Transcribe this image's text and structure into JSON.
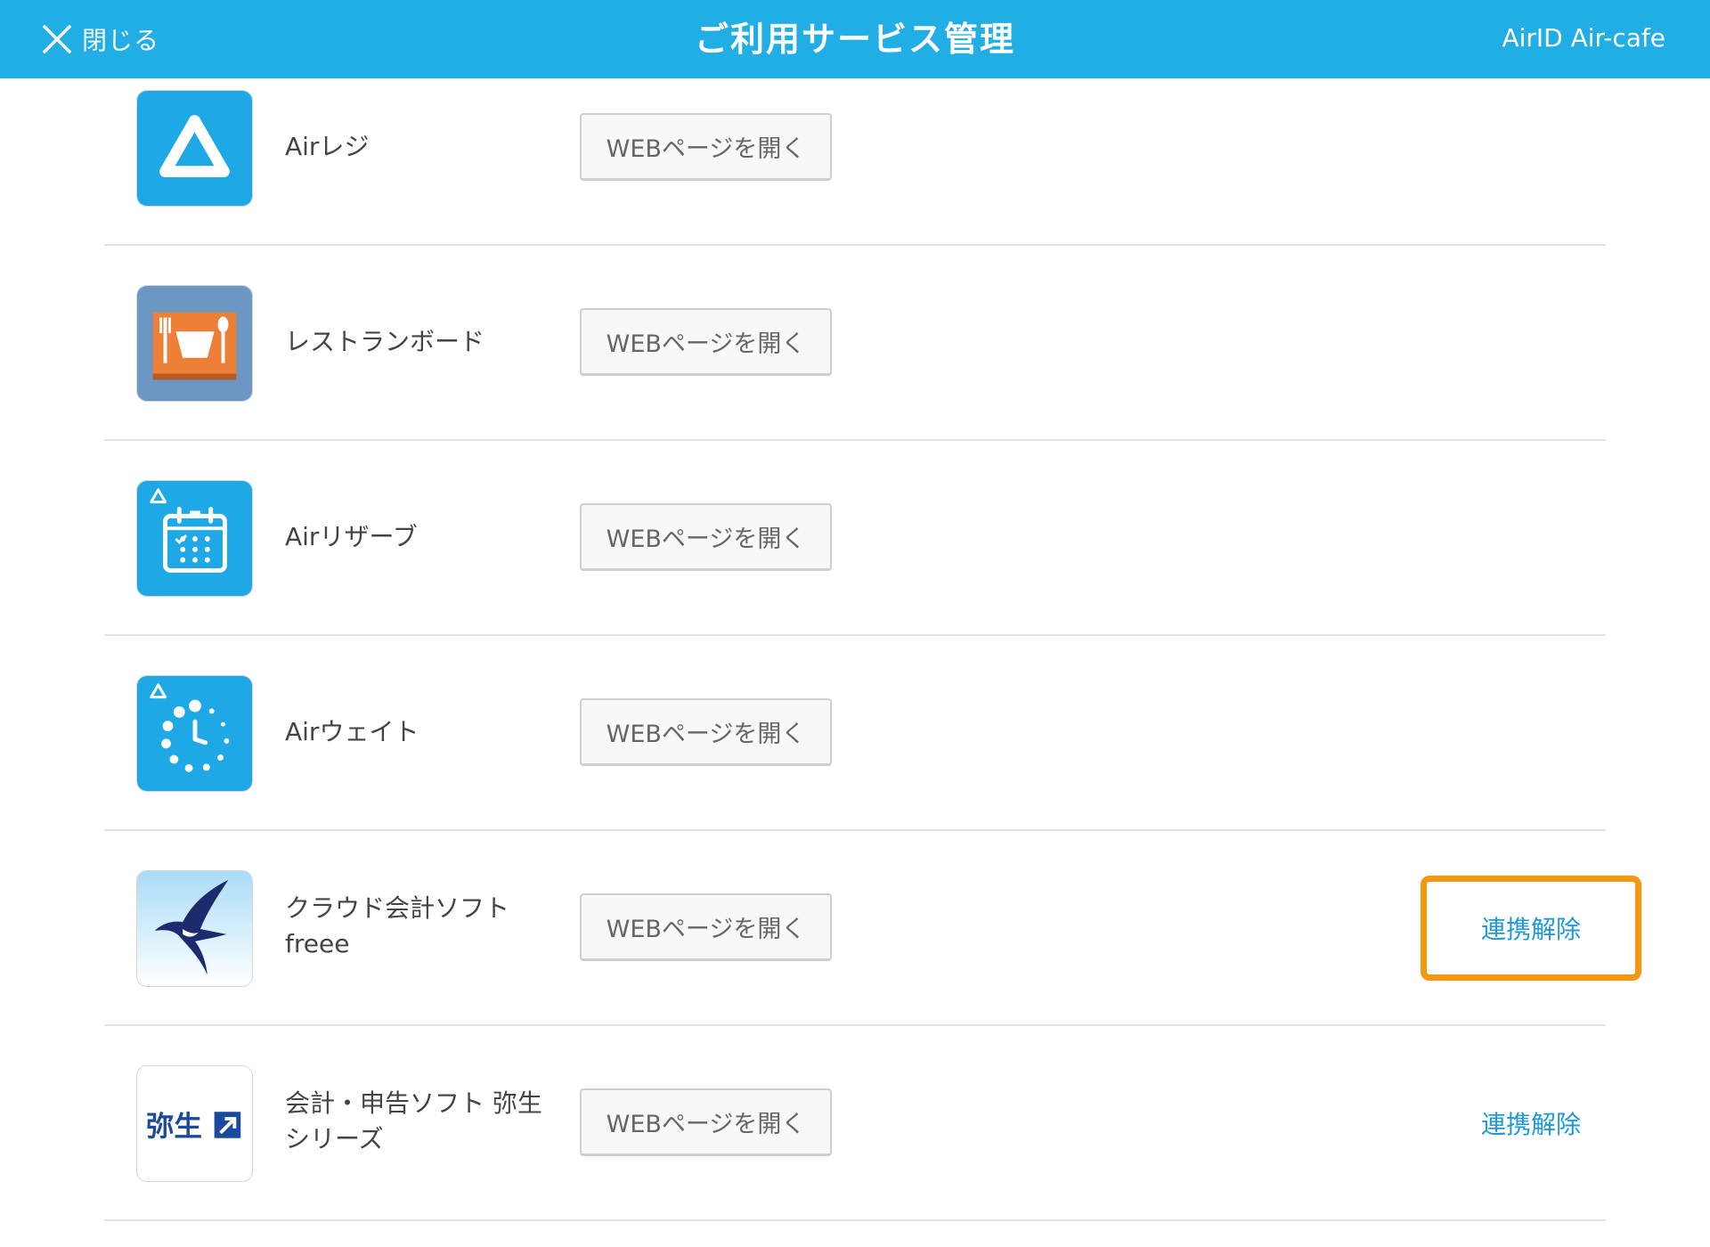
{
  "header": {
    "close_label": "閉じる",
    "title": "ご利用サービス管理",
    "account": "AirID Air-cafe",
    "bg_color": "#20aee4"
  },
  "services": [
    {
      "icon": "air-regi-icon",
      "name": "Airレジ",
      "web_button": "WEBページを開く"
    },
    {
      "icon": "restaurant-board-icon",
      "name": "レストランボード",
      "web_button": "WEBページを開く"
    },
    {
      "icon": "air-reserve-icon",
      "name": "Airリザーブ",
      "web_button": "WEBページを開く"
    },
    {
      "icon": "air-wait-icon",
      "name": "Airウェイト",
      "web_button": "WEBページを開く"
    },
    {
      "icon": "freee-swallow-icon",
      "name_line1": "クラウド会計ソフト",
      "name_line2": "freee",
      "web_button": "WEBページを開く",
      "unlink_button": "連携解除",
      "highlighted": true
    },
    {
      "icon": "yayoi-logo-icon",
      "name_line1": "会計・申告ソフト 弥生",
      "name_line2": "シリーズ",
      "web_button": "WEBページを開く",
      "unlink_button": "連携解除",
      "highlighted": false,
      "logo_text": "弥生"
    }
  ],
  "colors": {
    "accent": "#20aee4",
    "link": "#1d9ad7",
    "highlight": "#f7970f"
  }
}
